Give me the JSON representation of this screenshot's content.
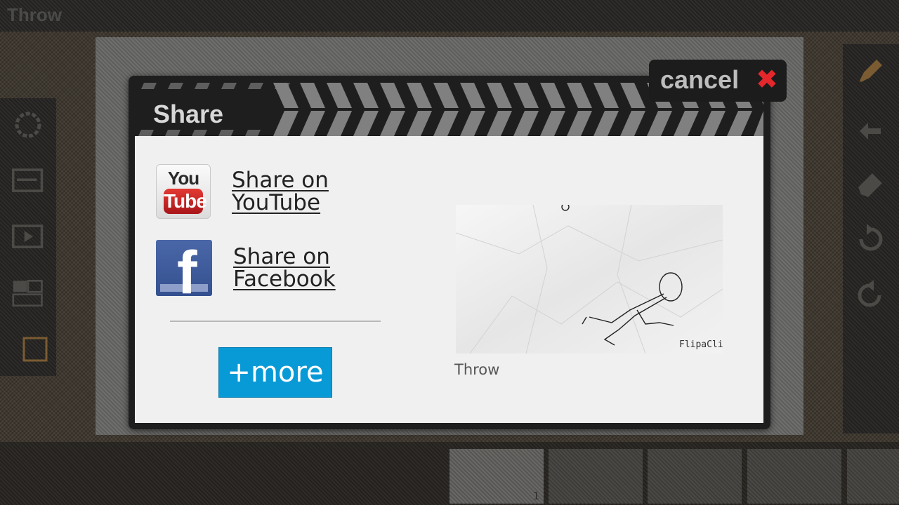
{
  "app": {
    "title": "Throw"
  },
  "left_toolbar": {
    "tools": [
      {
        "icon": "settings-ring-icon"
      },
      {
        "icon": "layers-icon"
      },
      {
        "icon": "play-frame-icon"
      },
      {
        "icon": "onion-skin-icon"
      },
      {
        "icon": "background-frame-icon"
      }
    ]
  },
  "right_toolbar": {
    "tools": [
      {
        "icon": "pencil-icon"
      },
      {
        "icon": "hand-icon"
      },
      {
        "icon": "eraser-icon"
      },
      {
        "icon": "undo-icon"
      },
      {
        "icon": "redo-icon"
      }
    ]
  },
  "timeline": {
    "frames": [
      "1",
      "",
      "",
      "",
      ""
    ]
  },
  "dialog": {
    "title": "Share",
    "cancel_label": "cancel",
    "cancel_icon": "close-x-icon",
    "youtube": {
      "icon_you": "You",
      "icon_tube": "Tube",
      "line1": "Share on",
      "line2": "YouTube"
    },
    "facebook": {
      "icon_letter": "f",
      "line1": "Share on",
      "line2": "Facebook"
    },
    "more_label": "+more",
    "preview": {
      "caption": "Throw",
      "watermark": "FlipaClip"
    }
  },
  "colors": {
    "accent": "#089ad6",
    "cancel_x": "#e5272c",
    "dialog_bg": "#1e1e1e",
    "panel_bg": "#f0f0f0"
  }
}
